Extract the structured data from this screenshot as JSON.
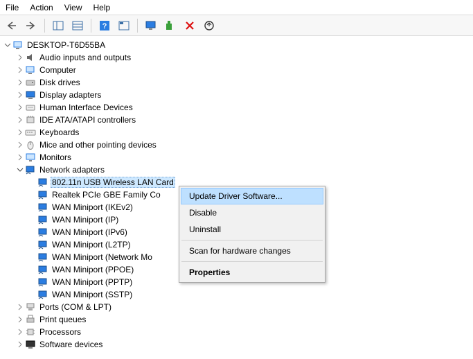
{
  "menubar": {
    "file": "File",
    "action": "Action",
    "view": "View",
    "help": "Help"
  },
  "root": "DESKTOP-T6D55BA",
  "categories": {
    "audio": "Audio inputs and outputs",
    "computer": "Computer",
    "disk": "Disk drives",
    "display": "Display adapters",
    "hid": "Human Interface Devices",
    "ide": "IDE ATA/ATAPI controllers",
    "keyboards": "Keyboards",
    "mice": "Mice and other pointing devices",
    "monitors": "Monitors",
    "network": "Network adapters",
    "ports": "Ports (COM & LPT)",
    "printqueues": "Print queues",
    "processors": "Processors",
    "software": "Software devices"
  },
  "network_children": [
    "802.11n USB Wireless LAN Card",
    "Realtek PCIe GBE Family Co",
    "WAN Miniport (IKEv2)",
    "WAN Miniport (IP)",
    "WAN Miniport (IPv6)",
    "WAN Miniport (L2TP)",
    "WAN Miniport (Network Mo",
    "WAN Miniport (PPOE)",
    "WAN Miniport (PPTP)",
    "WAN Miniport (SSTP)"
  ],
  "context_menu": {
    "update": "Update Driver Software...",
    "disable": "Disable",
    "uninstall": "Uninstall",
    "scan": "Scan for hardware changes",
    "properties": "Properties"
  }
}
